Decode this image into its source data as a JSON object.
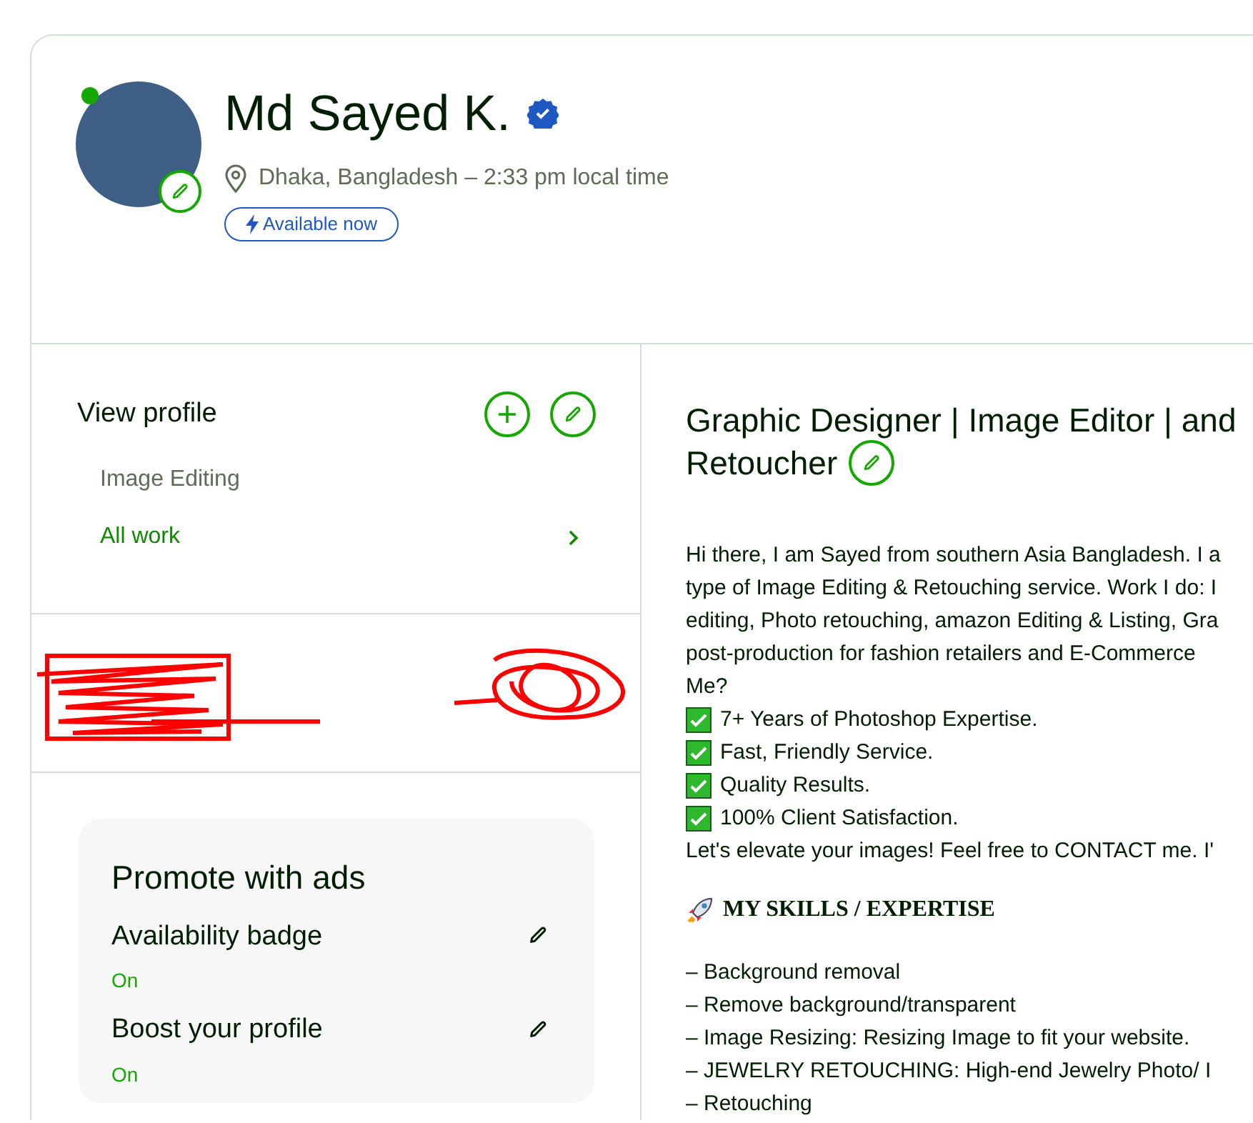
{
  "profile": {
    "name": "Md Sayed K.",
    "online": true,
    "verified": true,
    "location": "Dhaka, Bangladesh – 2:33 pm local time",
    "availability": "Available now"
  },
  "sidebar": {
    "title": "View profile",
    "items": [
      {
        "label": "Image Editing",
        "selected": false
      },
      {
        "label": "All work",
        "selected": true
      }
    ]
  },
  "promote": {
    "title": "Promote with ads",
    "items": [
      {
        "label": "Availability badge",
        "status": "On"
      },
      {
        "label": "Boost your profile",
        "status": "On"
      }
    ]
  },
  "main": {
    "title_lines": [
      "Graphic Designer | Image Editor | and",
      "Retoucher"
    ],
    "intro_lines": [
      "Hi there, I am Sayed from southern Asia Bangladesh. I a",
      "type of Image Editing & Retouching service. Work I do: I",
      "editing, Photo retouching, amazon Editing & Listing, Gra",
      "post-production for fashion retailers and E-Commerce",
      "Me?"
    ],
    "checklist": [
      "7+ Years of Photoshop Expertise.",
      "Fast, Friendly Service.",
      "Quality Results.",
      "100% Client Satisfaction."
    ],
    "closing": "Let's elevate your images! Feel free to CONTACT me. I'",
    "skills_heading": "MY SKILLS / EXPERTISE",
    "skills": [
      "– Background removal",
      "– Remove background/transparent",
      "– Image Resizing: Resizing Image to fit your website.",
      "– JEWELRY RETOUCHING: High-end Jewelry Photo/ I",
      "– Retouching"
    ]
  }
}
